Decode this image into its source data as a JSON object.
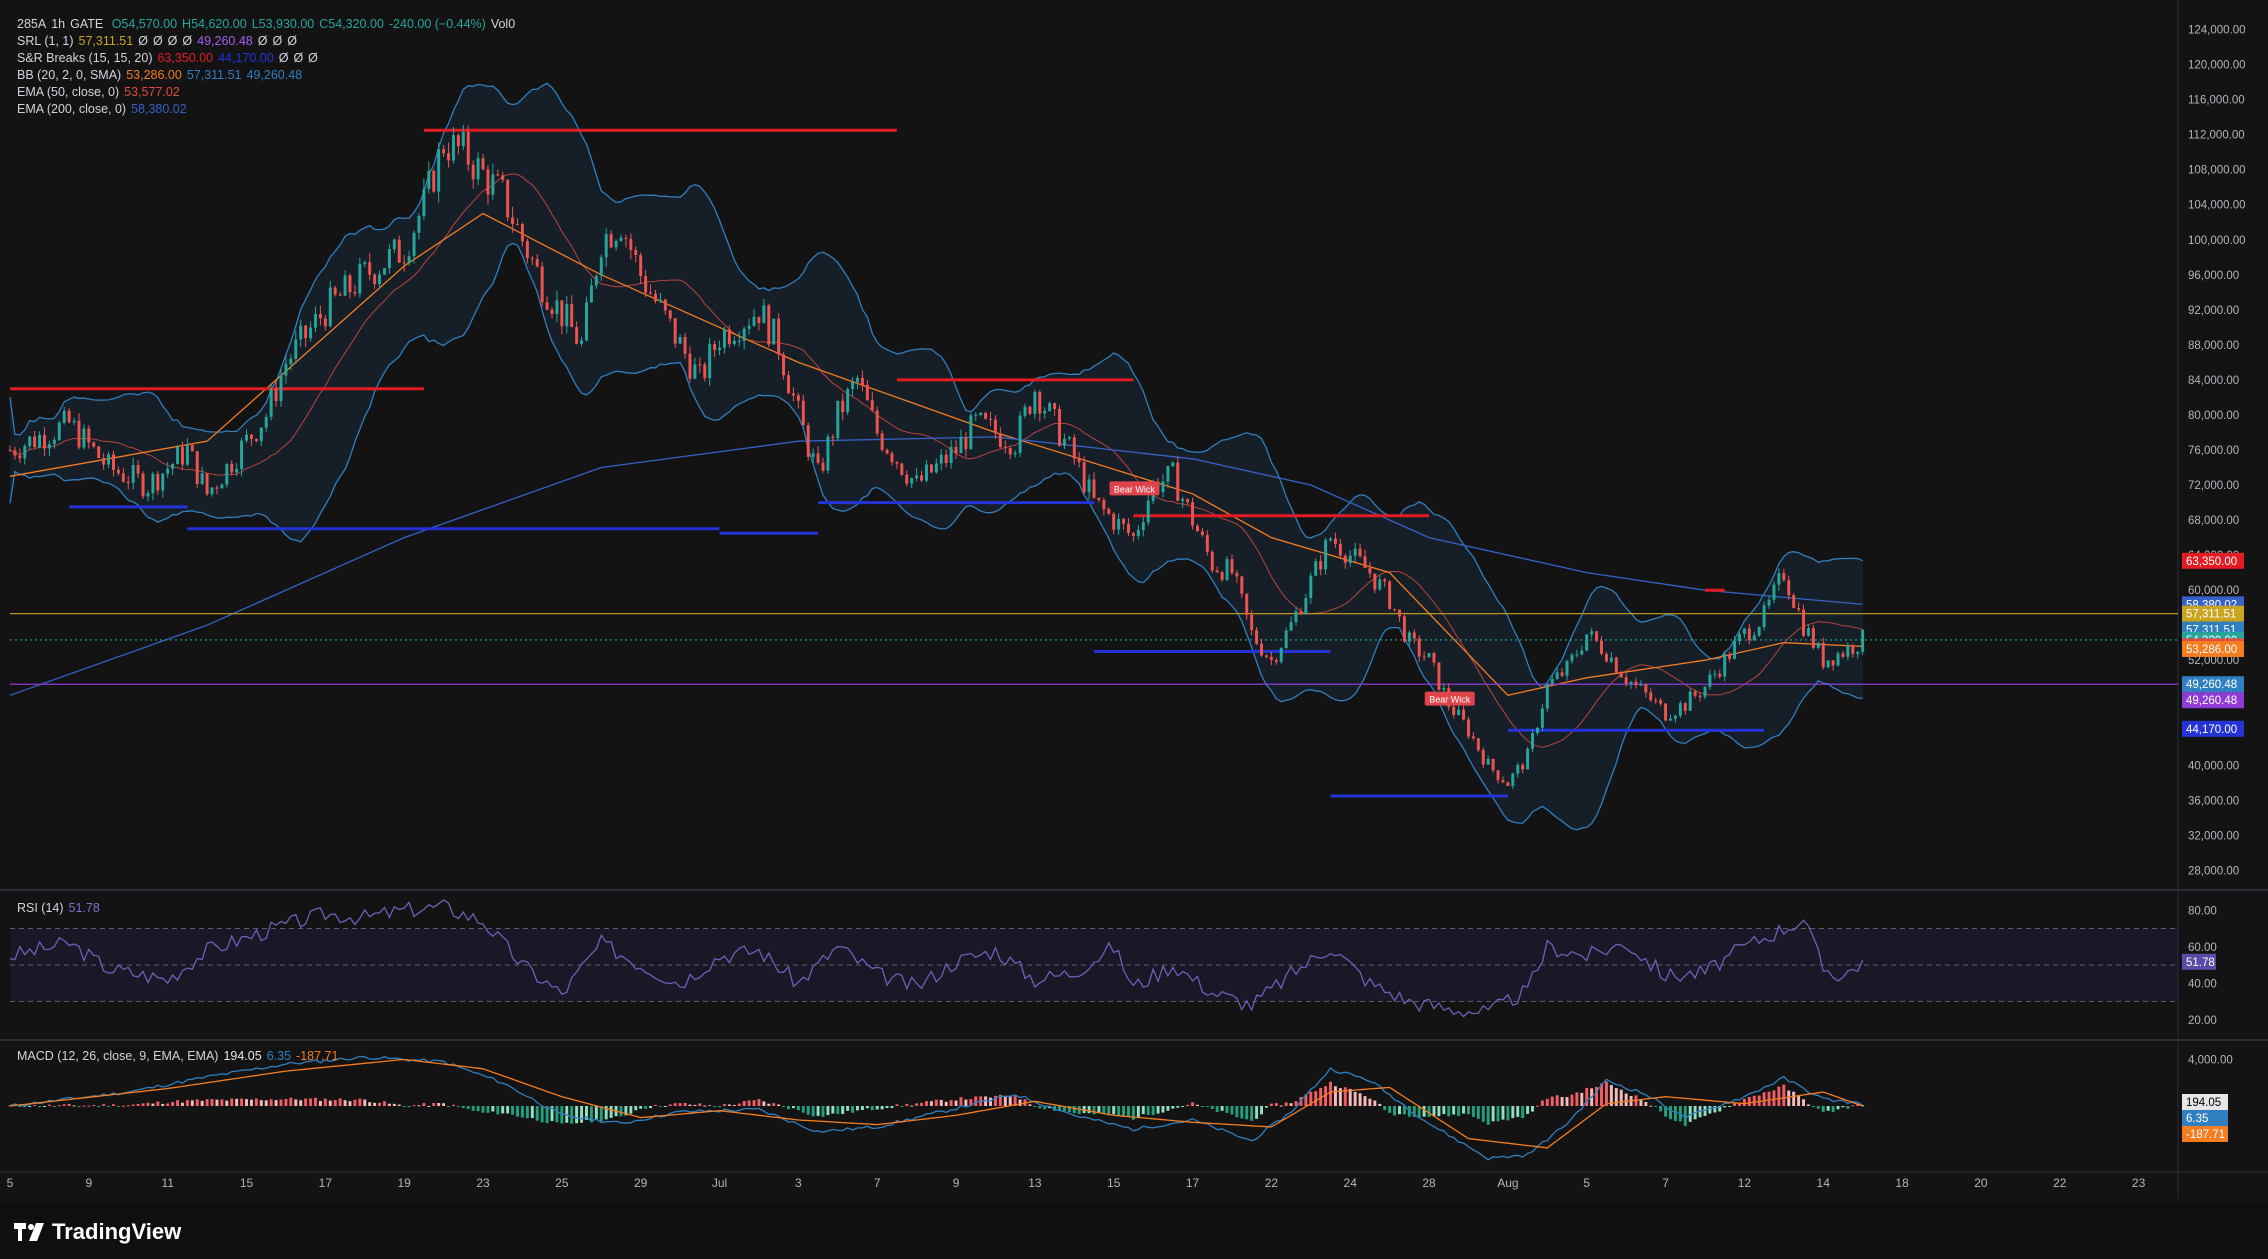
{
  "header": {
    "symbol": "285A",
    "interval": "1h",
    "exchange": "GATE",
    "open": "O54,570.00",
    "high": "H54,620.00",
    "low": "L53,930.00",
    "close": "C54,320.00",
    "change": "-240.00 (−0.44%)",
    "volume": "Vol0"
  },
  "indicators": [
    {
      "label": "SRL (1, 1)",
      "values": [
        "57,311.51",
        "Ø",
        "Ø",
        "Ø",
        "Ø",
        "49,260.48",
        "Ø",
        "Ø",
        "Ø"
      ]
    },
    {
      "label": "S&R Breaks (15, 15, 20)",
      "values": [
        "63,350.00",
        "44,170.00",
        "Ø",
        "Ø",
        "Ø"
      ]
    },
    {
      "label": "BB (20, 2, 0, SMA)",
      "values": [
        "53,286.00",
        "57,311.51",
        "49,260.48"
      ]
    },
    {
      "label": "EMA (50, close, 0)",
      "values": [
        "53,577.02"
      ]
    },
    {
      "label": "EMA (200, close, 0)",
      "values": [
        "58,380.02"
      ]
    }
  ],
  "colors": {
    "background": "#131313",
    "bull": "#26a69a",
    "bear": "#ef5350",
    "resistance": "#e31b23",
    "support": "#2333d6",
    "bb_band": "#2f7fc1",
    "bb_basis": "#e14b41",
    "ema50": "#f57c1f",
    "ema200": "#3561c9",
    "srl_top": "#c8a51e",
    "srl_bottom": "#8e3bd6",
    "rsi": "#6f5fb8",
    "macd_line": "#2f7fc1",
    "signal_line": "#f57c1f"
  },
  "chart_data": {
    "type": "candlestick",
    "title": "285A · 1h · GATE",
    "ylim": [
      26000,
      126000
    ],
    "y_ticks": [
      "124,000.00",
      "120,000.00",
      "116,000.00",
      "112,000.00",
      "108,000.00",
      "104,000.00",
      "100,000.00",
      "96,000.00",
      "92,000.00",
      "88,000.00",
      "84,000.00",
      "80,000.00",
      "76,000.00",
      "72,000.00",
      "68,000.00",
      "64,000.00",
      "60,000.00",
      "56,000.00",
      "52,000.00",
      "48,000.00",
      "44,000.00",
      "40,000.00",
      "36,000.00",
      "32,000.00",
      "28,000.00"
    ],
    "y_tick_values": [
      124000,
      120000,
      116000,
      112000,
      108000,
      104000,
      100000,
      96000,
      92000,
      88000,
      84000,
      80000,
      76000,
      72000,
      68000,
      64000,
      60000,
      56000,
      52000,
      48000,
      44000,
      40000,
      36000,
      32000,
      28000
    ],
    "x_ticks": [
      "5",
      "9",
      "11",
      "15",
      "17",
      "19",
      "23",
      "25",
      "29",
      "Jul",
      "3",
      "7",
      "9",
      "13",
      "15",
      "17",
      "22",
      "24",
      "28",
      "Aug",
      "5",
      "7",
      "12",
      "14",
      "18",
      "20",
      "22",
      "23"
    ],
    "x_tick_day_index": [
      0,
      4,
      8,
      12,
      16,
      20,
      24,
      28,
      32,
      36,
      40,
      44,
      48,
      52,
      56,
      60,
      64,
      68,
      72,
      76,
      80,
      84,
      88,
      92,
      96,
      100,
      104,
      108
    ],
    "day_axis_max": 110,
    "last_data_day": 94,
    "close_path": [
      [
        0,
        76000
      ],
      [
        3,
        79000
      ],
      [
        5,
        74000
      ],
      [
        7,
        72000
      ],
      [
        9,
        76000
      ],
      [
        10,
        71000
      ],
      [
        11,
        74000
      ],
      [
        13,
        80000
      ],
      [
        14,
        86000
      ],
      [
        16,
        92000
      ],
      [
        18,
        96000
      ],
      [
        20,
        99000
      ],
      [
        21,
        104000
      ],
      [
        22,
        111000
      ],
      [
        23,
        110000
      ],
      [
        25,
        105000
      ],
      [
        27,
        95000
      ],
      [
        29,
        88000
      ],
      [
        30,
        100000
      ],
      [
        31,
        102000
      ],
      [
        32,
        96000
      ],
      [
        34,
        88000
      ],
      [
        35,
        84000
      ],
      [
        36,
        89000
      ],
      [
        38,
        92000
      ],
      [
        39,
        88000
      ],
      [
        40,
        80000
      ],
      [
        41,
        73000
      ],
      [
        42,
        80000
      ],
      [
        43,
        84000
      ],
      [
        44,
        78000
      ],
      [
        46,
        72000
      ],
      [
        48,
        76000
      ],
      [
        49,
        79000
      ],
      [
        51,
        77000
      ],
      [
        52,
        83000
      ],
      [
        54,
        75000
      ],
      [
        55,
        70000
      ],
      [
        57,
        66000
      ],
      [
        58,
        72000
      ],
      [
        59,
        73000
      ],
      [
        60,
        68000
      ],
      [
        61,
        63000
      ],
      [
        62,
        62000
      ],
      [
        63,
        55000
      ],
      [
        64,
        52000
      ],
      [
        65,
        56000
      ],
      [
        66,
        61000
      ],
      [
        67,
        66000
      ],
      [
        68,
        64000
      ],
      [
        69,
        62000
      ],
      [
        70,
        59000
      ],
      [
        71,
        54000
      ],
      [
        72,
        52000
      ],
      [
        73,
        47000
      ],
      [
        74,
        44000
      ],
      [
        75,
        40000
      ],
      [
        76,
        38000
      ],
      [
        77,
        41000
      ],
      [
        78,
        49000
      ],
      [
        79,
        51000
      ],
      [
        80,
        55000
      ],
      [
        81,
        53000
      ],
      [
        82,
        50000
      ],
      [
        83,
        48000
      ],
      [
        84,
        46000
      ],
      [
        85,
        47000
      ],
      [
        86,
        49000
      ],
      [
        87,
        52000
      ],
      [
        88,
        55000
      ],
      [
        89,
        57000
      ],
      [
        90,
        62000
      ],
      [
        91,
        56000
      ],
      [
        92,
        52000
      ],
      [
        93,
        53000
      ],
      [
        94,
        54320
      ]
    ],
    "ema50_path": [
      [
        0,
        73000
      ],
      [
        10,
        77000
      ],
      [
        20,
        97000
      ],
      [
        24,
        103000
      ],
      [
        30,
        96000
      ],
      [
        40,
        86000
      ],
      [
        50,
        78000
      ],
      [
        60,
        71000
      ],
      [
        64,
        66000
      ],
      [
        70,
        62000
      ],
      [
        76,
        48000
      ],
      [
        80,
        50000
      ],
      [
        86,
        52000
      ],
      [
        90,
        54000
      ],
      [
        94,
        53577
      ]
    ],
    "ema200_path": [
      [
        0,
        48000
      ],
      [
        10,
        56000
      ],
      [
        20,
        66000
      ],
      [
        30,
        74000
      ],
      [
        40,
        77000
      ],
      [
        50,
        77500
      ],
      [
        60,
        75000
      ],
      [
        66,
        72000
      ],
      [
        72,
        66000
      ],
      [
        80,
        62000
      ],
      [
        86,
        60000
      ],
      [
        94,
        58380
      ]
    ],
    "series": [
      {
        "name": "S&R Breaks resistance",
        "segments": [
          [
            [
              0,
              83000
            ],
            [
              21,
              83000
            ]
          ],
          [
            [
              21,
              112500
            ],
            [
              45,
              112500
            ]
          ],
          [
            [
              45,
              84000
            ],
            [
              57,
              84000
            ]
          ],
          [
            [
              57,
              68500
            ],
            [
              72,
              68500
            ]
          ],
          [
            [
              86,
              60500
            ],
            [
              86,
              60500
            ]
          ],
          [
            [
              86,
              60000
            ],
            [
              87,
              60000
            ]
          ]
        ]
      },
      {
        "name": "S&R Breaks support",
        "segments": [
          [
            [
              3,
              69500
            ],
            [
              9,
              69500
            ]
          ],
          [
            [
              9,
              67000
            ],
            [
              36,
              67000
            ]
          ],
          [
            [
              36,
              66500
            ],
            [
              41,
              66500
            ]
          ],
          [
            [
              41,
              70000
            ],
            [
              55,
              70000
            ]
          ],
          [
            [
              55,
              53000
            ],
            [
              67,
              53000
            ]
          ],
          [
            [
              67,
              36500
            ],
            [
              76,
              36500
            ]
          ],
          [
            [
              76,
              44000
            ],
            [
              89,
              44000
            ]
          ]
        ]
      }
    ],
    "price_labels": [
      {
        "value": "63,350.00",
        "color": "#e31b23"
      },
      {
        "value": "58,380.02",
        "color": "#3561c9"
      },
      {
        "value": "57,311.51",
        "color": "#c8a51e"
      },
      {
        "value": "57,311.51",
        "color": "#2f7fc1"
      },
      {
        "value": "54,320.00",
        "color": "#26a69a"
      },
      {
        "value": "53,577.02",
        "color": "#e14b41"
      },
      {
        "value": "53,286.00",
        "color": "#f57c1f"
      },
      {
        "value": "49,260.48",
        "color": "#2f7fc1"
      },
      {
        "value": "49,260.48",
        "color": "#8e3bd6"
      },
      {
        "value": "44,170.00",
        "color": "#2333d6"
      }
    ],
    "price_label_values": [
      63350,
      58380.02,
      57311.51,
      57311.51,
      54320,
      53577.02,
      53286,
      49260.48,
      49260.48,
      44170
    ],
    "horizontal_lines": [
      {
        "name": "SRL upper",
        "value": 57311.51
      },
      {
        "name": "SRL lower",
        "value": 49260.48
      },
      {
        "name": "Last price",
        "value": 54320
      }
    ],
    "annotations": [
      {
        "text": "Bear Wick",
        "day": 57,
        "value": 71500
      },
      {
        "text": "Bear Wick",
        "day": 73,
        "value": 47500
      }
    ]
  },
  "rsi": {
    "label": "RSI (14)",
    "value": "51.78",
    "ticks": [
      "80.00",
      "60.00",
      "40.00",
      "20.00"
    ],
    "tick_values": [
      80,
      60,
      40,
      20
    ],
    "upper": 70,
    "middle": 50,
    "lower": 30,
    "path": [
      [
        0,
        55
      ],
      [
        3,
        62
      ],
      [
        5,
        48
      ],
      [
        8,
        42
      ],
      [
        10,
        58
      ],
      [
        12,
        65
      ],
      [
        14,
        72
      ],
      [
        16,
        78
      ],
      [
        18,
        76
      ],
      [
        20,
        80
      ],
      [
        22,
        82
      ],
      [
        24,
        74
      ],
      [
        26,
        50
      ],
      [
        28,
        34
      ],
      [
        30,
        62
      ],
      [
        32,
        50
      ],
      [
        34,
        40
      ],
      [
        36,
        55
      ],
      [
        38,
        58
      ],
      [
        40,
        40
      ],
      [
        42,
        60
      ],
      [
        44,
        45
      ],
      [
        46,
        38
      ],
      [
        48,
        52
      ],
      [
        50,
        58
      ],
      [
        52,
        42
      ],
      [
        54,
        46
      ],
      [
        56,
        60
      ],
      [
        57,
        38
      ],
      [
        59,
        50
      ],
      [
        61,
        35
      ],
      [
        63,
        28
      ],
      [
        65,
        45
      ],
      [
        67,
        60
      ],
      [
        69,
        40
      ],
      [
        71,
        30
      ],
      [
        73,
        26
      ],
      [
        75,
        24
      ],
      [
        77,
        36
      ],
      [
        78,
        60
      ],
      [
        80,
        55
      ],
      [
        82,
        62
      ],
      [
        84,
        44
      ],
      [
        86,
        46
      ],
      [
        88,
        60
      ],
      [
        90,
        70
      ],
      [
        91,
        75
      ],
      [
        92,
        48
      ],
      [
        93,
        44
      ],
      [
        94,
        52
      ]
    ]
  },
  "macd": {
    "label": "MACD (12, 26, close, 9, EMA, EMA)",
    "macd_value": "194.05",
    "signal_value": "6.35",
    "hist_value": "-187.71",
    "ticks": [
      "4,000.00"
    ],
    "tick_values": [
      4000
    ],
    "ylim": [
      -5500,
      5500
    ],
    "macd_path": [
      [
        0,
        0
      ],
      [
        6,
        1200
      ],
      [
        10,
        2500
      ],
      [
        14,
        3600
      ],
      [
        18,
        4200
      ],
      [
        22,
        3800
      ],
      [
        25,
        2000
      ],
      [
        28,
        -800
      ],
      [
        31,
        -1500
      ],
      [
        34,
        -500
      ],
      [
        38,
        -300
      ],
      [
        41,
        -2200
      ],
      [
        44,
        -1800
      ],
      [
        48,
        -200
      ],
      [
        51,
        1000
      ],
      [
        54,
        -800
      ],
      [
        57,
        -2000
      ],
      [
        60,
        -1200
      ],
      [
        63,
        -3000
      ],
      [
        65,
        -500
      ],
      [
        67,
        3200
      ],
      [
        69,
        2200
      ],
      [
        72,
        -1500
      ],
      [
        75,
        -4500
      ],
      [
        77,
        -4200
      ],
      [
        79,
        -1500
      ],
      [
        81,
        2200
      ],
      [
        83,
        1000
      ],
      [
        85,
        -1000
      ],
      [
        88,
        800
      ],
      [
        90,
        2400
      ],
      [
        92,
        600
      ],
      [
        94,
        194
      ]
    ],
    "signal_path": [
      [
        0,
        0
      ],
      [
        8,
        1500
      ],
      [
        14,
        3000
      ],
      [
        20,
        4000
      ],
      [
        24,
        3200
      ],
      [
        28,
        800
      ],
      [
        32,
        -1000
      ],
      [
        36,
        -400
      ],
      [
        40,
        -1200
      ],
      [
        44,
        -1600
      ],
      [
        48,
        -800
      ],
      [
        52,
        400
      ],
      [
        56,
        -800
      ],
      [
        60,
        -1400
      ],
      [
        64,
        -1800
      ],
      [
        67,
        1200
      ],
      [
        70,
        1600
      ],
      [
        74,
        -2800
      ],
      [
        78,
        -3600
      ],
      [
        81,
        200
      ],
      [
        84,
        800
      ],
      [
        88,
        200
      ],
      [
        92,
        1200
      ],
      [
        94,
        6
      ]
    ]
  },
  "branding": {
    "name": "TradingView"
  }
}
